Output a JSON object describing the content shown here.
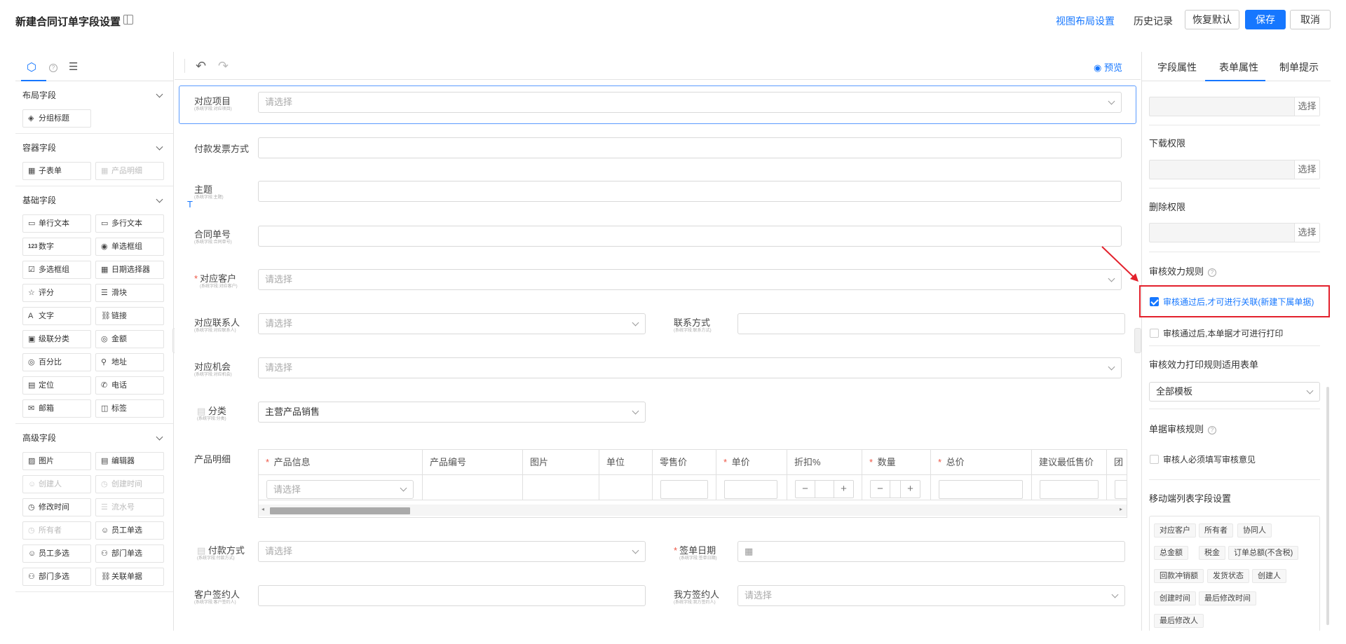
{
  "header": {
    "title": "新建合同订单字段设置",
    "view_layout": "视图布局设置",
    "history": "历史记录",
    "restore_default": "恢复默认",
    "save": "保存",
    "cancel": "取消"
  },
  "left": {
    "groups": [
      {
        "title": "布局字段",
        "items": [
          {
            "label": "分组标题",
            "icon": "◈"
          }
        ]
      },
      {
        "title": "容器字段",
        "items": [
          {
            "label": "子表单",
            "icon": "▦"
          },
          {
            "label": "产品明细",
            "icon": "▦",
            "disabled": true
          }
        ]
      },
      {
        "title": "基础字段",
        "items": [
          {
            "label": "单行文本",
            "icon": "▭"
          },
          {
            "label": "多行文本",
            "icon": "▭"
          },
          {
            "label": "数字",
            "icon": "123"
          },
          {
            "label": "单选框组",
            "icon": "◉"
          },
          {
            "label": "多选框组",
            "icon": "☑"
          },
          {
            "label": "日期选择器",
            "icon": "▦"
          },
          {
            "label": "评分",
            "icon": "☆"
          },
          {
            "label": "滑块",
            "icon": "☰"
          },
          {
            "label": "文字",
            "icon": "A"
          },
          {
            "label": "链接",
            "icon": "⛓"
          },
          {
            "label": "级联分类",
            "icon": "▣"
          },
          {
            "label": "金额",
            "icon": "◎"
          },
          {
            "label": "百分比",
            "icon": "◎"
          },
          {
            "label": "地址",
            "icon": "⚲"
          },
          {
            "label": "定位",
            "icon": "▤"
          },
          {
            "label": "电话",
            "icon": "✆"
          },
          {
            "label": "邮箱",
            "icon": "✉"
          },
          {
            "label": "标签",
            "icon": "◫"
          }
        ]
      },
      {
        "title": "高级字段",
        "items": [
          {
            "label": "图片",
            "icon": "▨"
          },
          {
            "label": "编辑器",
            "icon": "▤"
          },
          {
            "label": "创建人",
            "icon": "☺",
            "disabled": true
          },
          {
            "label": "创建时间",
            "icon": "◷",
            "disabled": true
          },
          {
            "label": "修改时间",
            "icon": "◷"
          },
          {
            "label": "流水号",
            "icon": "☰",
            "disabled": true
          },
          {
            "label": "所有者",
            "icon": "◷",
            "disabled": true
          },
          {
            "label": "员工单选",
            "icon": "☺"
          },
          {
            "label": "员工多选",
            "icon": "☺"
          },
          {
            "label": "部门单选",
            "icon": "⚇"
          },
          {
            "label": "部门多选",
            "icon": "⚇"
          },
          {
            "label": "关联单据",
            "icon": "⛓"
          }
        ]
      }
    ]
  },
  "canvas": {
    "preview": "预览",
    "fields": {
      "project_label": "对应项目",
      "project_sub": "(系统字段:对应项目)",
      "project_ph": "请选择",
      "invoice_label": "付款发票方式",
      "subject_label": "主题",
      "subject_sub": "(系统字段:主题)",
      "contract_no_label": "合同单号",
      "contract_no_sub": "(系统字段:合同单号)",
      "customer_label": "对应客户",
      "customer_sub": "(系统字段:对应客户)",
      "customer_ph": "请选择",
      "contact_label": "对应联系人",
      "contact_sub": "(系统字段:对应联系人)",
      "contact_ph": "请选择",
      "phone_label": "联系方式",
      "phone_sub": "(系统字段:联系方式)",
      "opportunity_label": "对应机会",
      "opportunity_sub": "(系统字段:对应机会)",
      "opportunity_ph": "请选择",
      "category_label": "分类",
      "category_sub": "(系统字段:分类)",
      "category_value": "主营产品销售",
      "products_label": "产品明细",
      "payment_label": "付款方式",
      "payment_sub": "(系统字段:付款方式)",
      "payment_ph": "请选择",
      "sign_date_label": "签单日期",
      "sign_date_sub": "(系统字段:签单日期)",
      "cust_signer_label": "客户签约人",
      "cust_signer_sub": "(系统字段:客户签约人)",
      "our_signer_label": "我方签约人",
      "our_signer_sub": "(系统字段:我方签约人)",
      "our_signer_ph": "请选择"
    },
    "table": {
      "columns": [
        "产品信息",
        "产品编号",
        "图片",
        "单位",
        "零售价",
        "单价",
        "折扣%",
        "数量",
        "总价",
        "建议最低售价",
        "团"
      ],
      "row_select_ph": "请选择"
    }
  },
  "right": {
    "tabs": [
      "字段属性",
      "表单属性",
      "制单提示"
    ],
    "select_btn": "选择",
    "download_perm": "下载权限",
    "delete_perm": "删除权限",
    "audit_rule": "审核效力规则",
    "audit_opt1": "审核通过后,才可进行关联(新建下属单据)",
    "audit_opt2": "审核通过后,本单据才可进行打印",
    "print_rule": "审核效力打印规则适用表单",
    "all_templates": "全部模板",
    "doc_audit_rule": "单据审核规则",
    "must_comment": "审核人必须填写审核意见",
    "mobile_fields": "移动端列表字段设置",
    "tags": [
      "对应客户",
      "所有者",
      "协同人",
      "总金额",
      "税金",
      "订单总额(不含税)",
      "回款冲销额",
      "发货状态",
      "创建人",
      "创建时间",
      "最后修改时间",
      "最后修改人"
    ]
  }
}
